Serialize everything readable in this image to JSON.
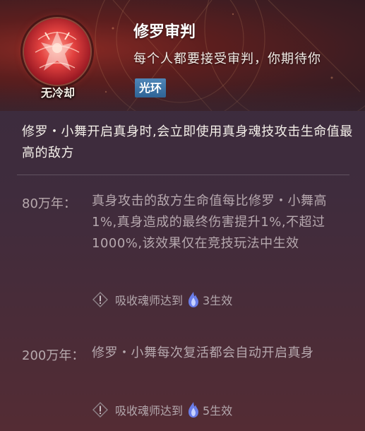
{
  "skill": {
    "icon": "asura-xiaowu-portrait-icon",
    "cooldown": "无冷却",
    "title": "修罗审判",
    "description": "每个人都要接受审判，你期待你",
    "tag": "光环"
  },
  "main_description": "修罗・小舞开启真身时,会立即使用真身魂技攻击生命值最高的敌方",
  "tiers": [
    {
      "label": "80万年：",
      "text": "真身攻击的敌方生命值每比修罗・小舞高1%,真身造成的最终伤害提升1%,不超过1000%,该效果仅在竞技玩法中生效",
      "requirement_prefix": "吸收魂师达到",
      "requirement_value": "3生效"
    },
    {
      "label": "200万年：",
      "text": "修罗・小舞每次复活都会自动开启真身",
      "requirement_prefix": "吸收魂师达到",
      "requirement_value": "5生效"
    }
  ],
  "icons": {
    "warning": "exclamation-diamond-icon",
    "soul": "blue-soul-flame-icon"
  },
  "colors": {
    "tag_blue": "#3a70a4",
    "tier_text": "#b6a8ae",
    "header_red": "#8a2a24"
  }
}
